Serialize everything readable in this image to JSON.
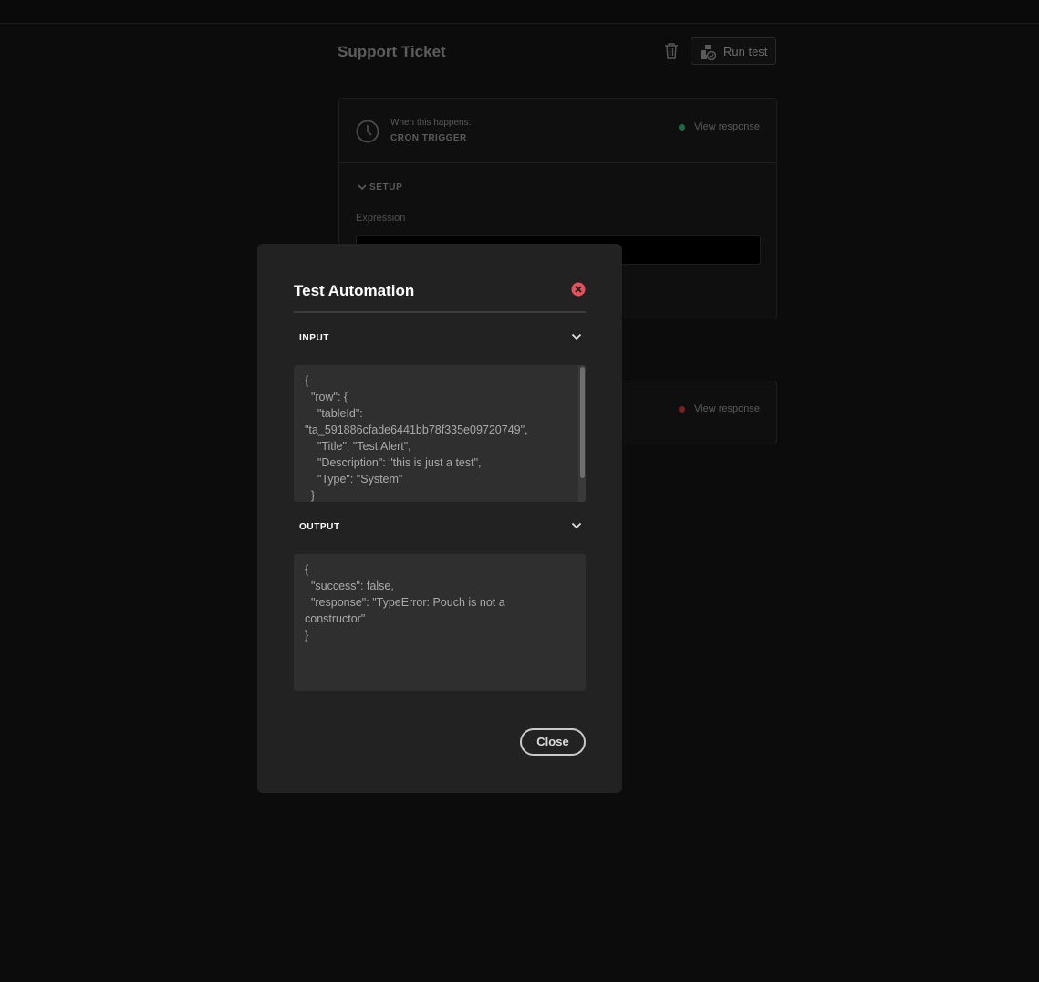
{
  "page": {
    "title": "Support Ticket",
    "run_test_label": "Run test"
  },
  "trigger_card": {
    "when_label": "When this happens:",
    "trigger_name": "CRON TRIGGER",
    "view_response": "View response",
    "status_color": "#1f6b4a",
    "setup_label": "SETUP",
    "expression_label": "Expression",
    "expression_value": ""
  },
  "step_card": {
    "view_response": "View response",
    "status_color": "#7a2323"
  },
  "modal": {
    "title": "Test Automation",
    "input_label": "INPUT",
    "input_json": "{\n  \"row\": {\n    \"tableId\":\n\"ta_591886cfade6441bb78f335e09720749\",\n    \"Title\": \"Test Alert\",\n    \"Description\": \"this is just a test\",\n    \"Type\": \"System\"\n  }\n}",
    "output_label": "OUTPUT",
    "output_json": "{\n  \"success\": false,\n  \"response\": \"TypeError: Pouch is not a\nconstructor\"\n}",
    "close_label": "Close",
    "close_icon_color": "#e8505b"
  }
}
